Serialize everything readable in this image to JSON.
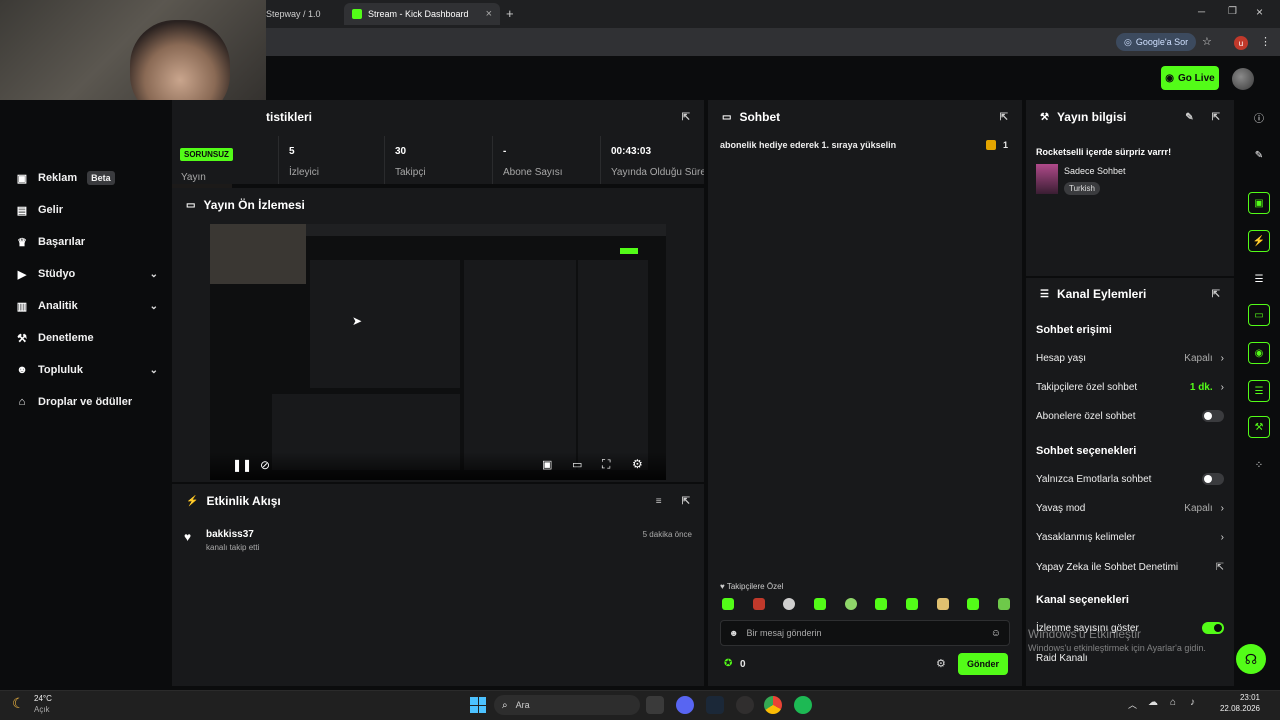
{
  "browser": {
    "tabs": [
      {
        "label": "Stepway / 1.0"
      },
      {
        "label": "Stream - Kick Dashboard",
        "active": true
      }
    ],
    "new_tab": "+",
    "google_ask": "Google'a Sor"
  },
  "header": {
    "go_live": "Go Live"
  },
  "sidebar": {
    "items": [
      {
        "label": "Reklam",
        "badge": "Beta",
        "icon": "megaphone-icon"
      },
      {
        "label": "Gelir",
        "icon": "bar-chart-icon"
      },
      {
        "label": "Başarılar",
        "icon": "trophy-icon"
      },
      {
        "label": "Stüdyo",
        "icon": "video-icon",
        "chevron": "⌄"
      },
      {
        "label": "Analitik",
        "icon": "chart-icon",
        "chevron": "⌄"
      },
      {
        "label": "Denetleme",
        "icon": "hammer-icon"
      },
      {
        "label": "Topluluk",
        "icon": "users-icon",
        "chevron": "⌄"
      },
      {
        "label": "Droplar ve ödüller",
        "icon": "gift-icon"
      }
    ]
  },
  "stats": {
    "title": "tistikleri",
    "status_badge": "SORUNSUZ",
    "status_label": "Yayın",
    "cells": [
      {
        "value": "5",
        "label": "İzleyici"
      },
      {
        "value": "30",
        "label": "Takipçi"
      },
      {
        "value": "-",
        "label": "Abone Sayısı"
      },
      {
        "value": "00:43:03",
        "label": "Yayında Olduğu Süre"
      }
    ]
  },
  "preview": {
    "title": "Yayın Ön İzlemesi"
  },
  "activity": {
    "title": "Etkinlik Akışı",
    "items": [
      {
        "user": "bakkiss37",
        "action": "kanalı takip etti",
        "time": "5 dakika önce"
      }
    ]
  },
  "chat": {
    "title": "Sohbet",
    "pinned": "abonelik hediye ederek 1. sıraya yükselin",
    "pinned_count": "1",
    "followers_only": "Takipçilere Özel",
    "input_placeholder": "Bir mesaj gönderin",
    "points": "0",
    "send": "Gönder"
  },
  "stream_info": {
    "title": "Yayın bilgisi",
    "stream_title": "Rocketselli içerde sürpriz varrr!",
    "category": "Sadece Sohbet",
    "language": "Turkish"
  },
  "channel_actions": {
    "title": "Kanal Eylemleri",
    "chat_access": "Sohbet erişimi",
    "account_age": {
      "label": "Hesap yaşı",
      "value": "Kapalı"
    },
    "followers_chat": {
      "label": "Takipçilere özel sohbet",
      "value": "1 dk."
    },
    "subscribers_chat": {
      "label": "Abonelere özel sohbet"
    },
    "chat_options": "Sohbet seçenekleri",
    "emotes_only": {
      "label": "Yalnızca Emotlarla sohbet"
    },
    "slow_mode": {
      "label": "Yavaş mod",
      "value": "Kapalı"
    },
    "banned_words": {
      "label": "Yasaklanmış kelimeler"
    },
    "ai_moderation": {
      "label": "Yapay Zeka ile Sohbet Denetimi"
    },
    "channel_options": "Kanal seçenekleri",
    "show_viewers": {
      "label": "İzlenme sayısını göster"
    },
    "raid": {
      "label": "Raid Kanalı"
    }
  },
  "watermark": {
    "line1": "Windows'u Etkinleştir",
    "line2": "Windows'u etkinleştirmek için Ayarlar'a gidin."
  },
  "taskbar": {
    "weather_temp": "24°C",
    "weather_desc": "Açık",
    "search": "Ara",
    "time": "23:01",
    "date": "22.08.2026"
  }
}
